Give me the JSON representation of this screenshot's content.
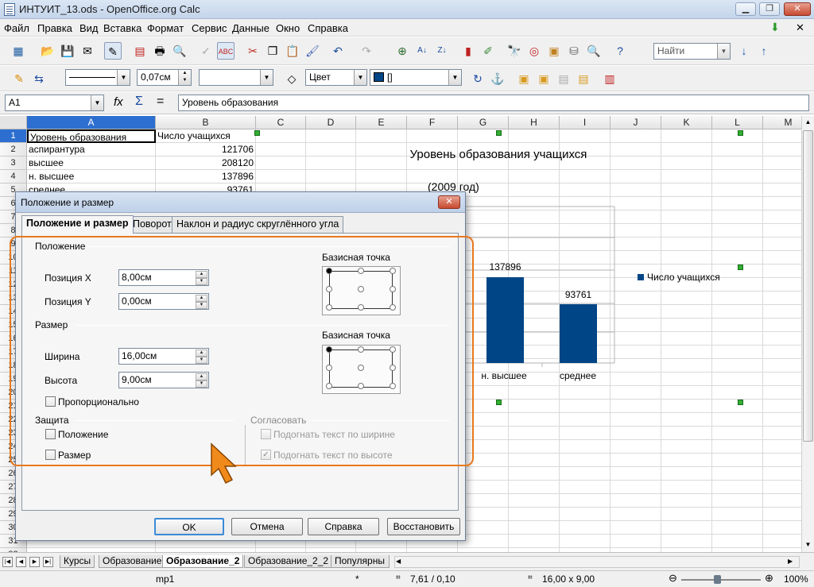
{
  "window": {
    "title": "ИНТУИТ_13.ods - OpenOffice.org Calc",
    "minimize_icon": "minimize-icon",
    "maximize_icon": "maximize-icon",
    "close_icon": "close-icon"
  },
  "menu": [
    "Файл",
    "Правка",
    "Вид",
    "Вставка",
    "Формат",
    "Сервис",
    "Данные",
    "Окно",
    "Справка"
  ],
  "toolbar2": {
    "line_width": "0,07см",
    "fill_mode": "Цвет",
    "fill_color": "[]",
    "find_placeholder": "Найти"
  },
  "formula": {
    "cell_ref": "A1",
    "content": "Уровень образования"
  },
  "columns": [
    "A",
    "B",
    "C",
    "D",
    "E",
    "F",
    "G",
    "H",
    "I",
    "J",
    "K",
    "L",
    "M"
  ],
  "rows_visible": [
    "1",
    "2",
    "3",
    "4",
    "5",
    "6",
    "7",
    "8",
    "9",
    "10",
    "11",
    "12",
    "13",
    "14",
    "15",
    "16",
    "17",
    "18",
    "19",
    "20",
    "21",
    "22",
    "23",
    "24",
    "25",
    "26",
    "27",
    "28",
    "29",
    "30",
    "31",
    "32"
  ],
  "cells": [
    {
      "a": "Уровень образования",
      "b": "Число учащихся"
    },
    {
      "a": "аспирантура",
      "b": "121706"
    },
    {
      "a": "высшее",
      "b": "208120"
    },
    {
      "a": "н. высшее",
      "b": "137896"
    },
    {
      "a": "среднее",
      "b": "93761"
    }
  ],
  "chart": {
    "title": "Уровень образования учащихся",
    "subtitle": "(2009 год)",
    "legend": "Число учащихся",
    "bars": [
      {
        "label": "н. высшее",
        "value": "137896"
      },
      {
        "label": "среднее",
        "value": "93761"
      }
    ],
    "color": "#004586"
  },
  "dialog": {
    "title": "Положение и размер",
    "tabs": [
      "Положение и размер",
      "Поворот",
      "Наклон и радиус скруглённого угла"
    ],
    "position_group": "Положение",
    "pos_x_label": "Позиция X",
    "pos_x_value": "8,00см",
    "pos_y_label": "Позиция Y",
    "pos_y_value": "0,00см",
    "base_point_label": "Базисная точка",
    "size_group": "Размер",
    "width_label": "Ширина",
    "width_value": "16,00см",
    "height_label": "Высота",
    "height_value": "9,00см",
    "base_point_label2": "Базисная точка",
    "proportional": "Пропорционально",
    "protect_group": "Защита",
    "protect_position": "Положение",
    "protect_size": "Размер",
    "fit_group": "Согласовать",
    "fit_width": "Подогнать текст по ширине",
    "fit_height": "Подогнать текст по высоте",
    "ok": "OK",
    "cancel": "Отмена",
    "help": "Справка",
    "reset": "Восстановить"
  },
  "sheet_tabs": [
    "Курсы",
    "Образование",
    "Образование_2",
    "Образование_2_2",
    "Популярны"
  ],
  "active_sheet": "Образование_2",
  "status": {
    "page_style": "mp1",
    "modified": "*",
    "position": "7,61 / 0,10",
    "size": "16,00 x 9,00",
    "zoom": "100%"
  },
  "accent": {
    "highlight": "#e8791e",
    "selection": "#0a4aa8"
  }
}
